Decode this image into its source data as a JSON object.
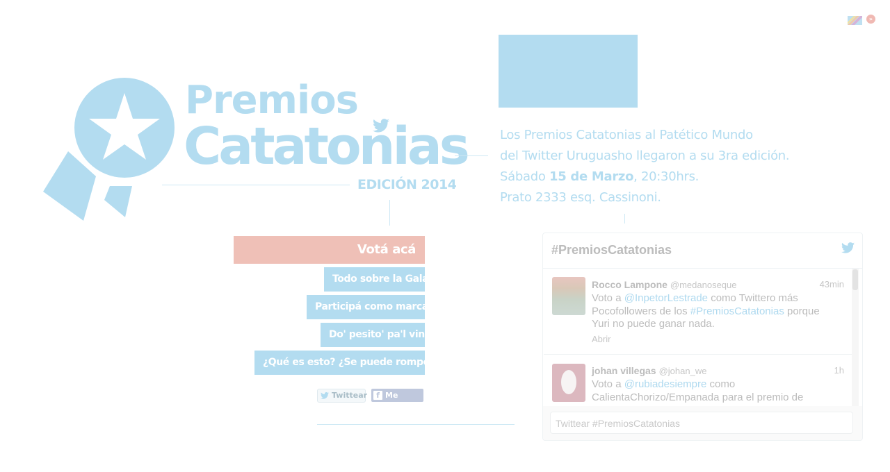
{
  "colors": {
    "brand": "#b3dcf0",
    "accent": "#efc0b7"
  },
  "header_icons": {
    "flag_icon": "flag-icon",
    "next_icon": "next-icon",
    "next_glyph": "»"
  },
  "logo": {
    "line1": "Premios",
    "line2": "Catatonias",
    "edition": "EDICIÓN 2014"
  },
  "description": {
    "line1": "Los Premios Catatonias al Patético Mundo",
    "line2": "del Twitter Uruguasho llegaron a su 3ra edición.",
    "line3_prefix": "Sábado ",
    "line3_bold": "15 de Marzo",
    "line3_suffix": ", 20:30hrs.",
    "line4": "Prato 2333 esq. Cassinoni."
  },
  "menu": {
    "vote": "Votá acá",
    "items": [
      "Todo sobre la Gala",
      "Participá como marca",
      "Do' pesito' pa'l vino",
      "¿Qué es esto? ¿Se puede romper?"
    ]
  },
  "social": {
    "tweet": "Twittear",
    "like": "Me gusta",
    "fb_glyph": "f"
  },
  "widget": {
    "title": "#PremiosCatatonias",
    "tweets": [
      {
        "name": "Rocco Lampone",
        "handle": "@medanoseque",
        "time": "43min",
        "text_a": "Voto a ",
        "mention": "@InpetorLestrade",
        "text_b": "  como Twittero más Pocofollowers de los ",
        "hashtag": "#PremiosCatatonias",
        "text_c": " porque Yuri no puede ganar nada.",
        "open": "Abrir"
      },
      {
        "name": "johan villegas",
        "handle": "@johan_we",
        "time": "1h",
        "text_a": "Voto a ",
        "mention": "@rubiadesiempre",
        "text_b": " como CalientaChorizo/Empanada para el premio de"
      }
    ],
    "compose_placeholder": "Twittear #PremiosCatatonias"
  }
}
